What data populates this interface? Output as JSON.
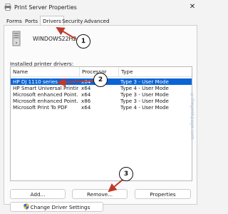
{
  "window": {
    "title": "Print Server Properties",
    "close_glyph": "✕",
    "icon": "printer-icon"
  },
  "tabs": [
    {
      "label": "Forms"
    },
    {
      "label": "Ports"
    },
    {
      "label": "Drivers",
      "active": true
    },
    {
      "label": "Security"
    },
    {
      "label": "Advanced"
    }
  ],
  "server": {
    "name": "WINDOWS22H2",
    "icon": "server-icon"
  },
  "drivers_section": {
    "label": "Installed printer drivers:",
    "columns": [
      "Name",
      "Processor",
      "Type"
    ],
    "rows": [
      {
        "name": "HP DJ 1110 series",
        "processor": "x64",
        "type": "Type 3 - User Mode",
        "selected": true
      },
      {
        "name": "HP Smart Universal Printing",
        "processor": "x64",
        "type": "Type 4 - User Mode"
      },
      {
        "name": "Microsoft enhanced Point...",
        "processor": "x64",
        "type": "Type 3 - User Mode"
      },
      {
        "name": "Microsoft enhanced Point...",
        "processor": "x86",
        "type": "Type 3 - User Mode"
      },
      {
        "name": "Microsoft Print To PDF",
        "processor": "x64",
        "type": "Type 4 - User Mode"
      }
    ]
  },
  "buttons": {
    "add": "Add...",
    "remove": "Remove...",
    "properties": "Properties",
    "change_driver_settings": "Change Driver Settings"
  },
  "callouts": [
    "1",
    "2",
    "3"
  ],
  "watermark": "©thegeekpage.com",
  "colors": {
    "selection": "#0a64d6",
    "arrow": "#c0392b"
  }
}
